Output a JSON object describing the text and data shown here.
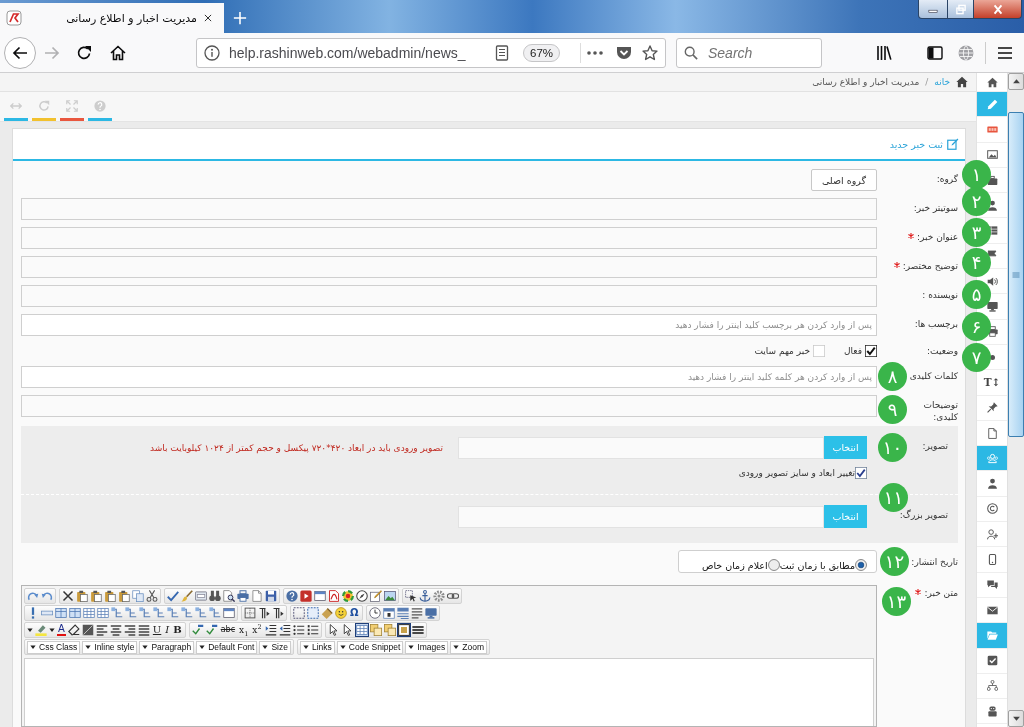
{
  "tabs": [
    {
      "title": "مدیریت اخبار و اطلاع رسانی",
      "selected": true
    }
  ],
  "navigation": {
    "back": {
      "disabled": false
    },
    "forward": {
      "disabled": true
    },
    "url": "help.rashinweb.com/webadmin/news_",
    "zoom": "67%",
    "search": {
      "placeholder": "Search"
    }
  },
  "breadcrumb": {
    "items": [
      {
        "label": "خانه",
        "kind": "link"
      },
      {
        "label": "مدیریت اخبار و اطلاع رسانی",
        "kind": "current"
      }
    ],
    "separator": "/"
  },
  "page_tools": [
    {
      "color": "#2cb8e4"
    },
    {
      "color": "#f2c12e"
    },
    {
      "color": "#e9573f"
    },
    {
      "color": "#2cb8e4"
    }
  ],
  "card": {
    "title": "ثبت خبر جدید"
  },
  "form": {
    "rows": [
      {
        "kind": "button",
        "label": "گروه:",
        "required": false,
        "button": "گروه اصلی"
      },
      {
        "kind": "text",
        "label": "سوتیتر خبر:",
        "required": false
      },
      {
        "kind": "text",
        "label": "عنوان خبر:",
        "required": true
      },
      {
        "kind": "text",
        "label": "توضیح مختصر:",
        "required": true
      },
      {
        "kind": "text",
        "label": "نویسنده :",
        "required": false
      },
      {
        "kind": "tags",
        "label": "برچسب ها:",
        "required": false,
        "placeholder": "پس از وارد کردن هر برچسب کلید اینتر را فشار دهید"
      },
      {
        "kind": "checks",
        "label": "وضعیت:",
        "required": false,
        "options": [
          {
            "label": "فعال",
            "checked": true
          },
          {
            "label": "خبر مهم سایت",
            "checked": false
          }
        ]
      },
      {
        "kind": "tags",
        "label": "کلمات کلیدی",
        "required": false,
        "placeholder": "پس از وارد کردن هر کلمه کلید اینتر را فشار دهید"
      },
      {
        "kind": "text",
        "label": "توضیحات کلیدی:",
        "required": false
      },
      {
        "kind": "file",
        "label": "تصویر:",
        "required": false,
        "button": "انتخاب",
        "note": "تصویر ورودی باید در ابعاد ۴۲۰*۷۲۰ پیکسل و حجم کمتر از ۱۰۲۴ کیلوبایت باشد",
        "option": {
          "label": "تغییر ابعاد و سایز تصویر ورودی",
          "checked": true
        }
      },
      {
        "kind": "file",
        "label": "تصویر بزرگ:",
        "required": false,
        "button": "انتخاب"
      },
      {
        "kind": "radios",
        "label": "تاریخ انتشار:",
        "required": false,
        "options": [
          {
            "label": "مطابق با زمان ثبت",
            "selected": true
          },
          {
            "label": "اعلام زمان خاص",
            "selected": false
          }
        ]
      },
      {
        "kind": "editor",
        "label": "متن خبر:",
        "required": true,
        "glyphs": [
          "Ω",
          "x$^{2}$",
          "x$_{1}$",
          "abc",
          "B",
          "I",
          "U",
          "A"
        ],
        "toggles": [
          {
            "on": true
          },
          {
            "on": true
          }
        ],
        "dropdown_groups": [
          [
            "Zoom",
            "Images",
            "Code Snippet",
            "Links"
          ],
          [
            "Size",
            "Default Font",
            "Paragraph",
            "Inline style",
            "Css Class"
          ]
        ]
      }
    ]
  },
  "sidebar": {
    "items": [
      {
        "selected": false
      },
      {
        "selected": true
      },
      {
        "selected": false
      },
      {
        "selected": false
      },
      {
        "selected": false
      },
      {
        "selected": false
      },
      {
        "selected": false
      },
      {
        "selected": false
      },
      {
        "selected": false
      },
      {
        "selected": false
      },
      {
        "selected": false
      },
      {
        "selected": false
      },
      {
        "selected": false,
        "glyph": "T↕"
      },
      {
        "selected": false
      },
      {
        "selected": false
      },
      {
        "selected": true
      },
      {
        "selected": false
      },
      {
        "selected": false
      },
      {
        "selected": false
      },
      {
        "selected": false
      },
      {
        "selected": false
      },
      {
        "selected": false
      },
      {
        "selected": true
      },
      {
        "selected": false
      },
      {
        "selected": false
      },
      {
        "selected": false
      }
    ]
  },
  "annotations": [
    {
      "label": "۱"
    },
    {
      "label": "۲"
    },
    {
      "label": "۳"
    },
    {
      "label": "۴"
    },
    {
      "label": "۵"
    },
    {
      "label": "۶"
    },
    {
      "label": "۷"
    },
    {
      "label": "۸"
    },
    {
      "label": "۹"
    },
    {
      "label": "۱۰"
    },
    {
      "label": "۱۱"
    },
    {
      "label": "۱۲"
    },
    {
      "label": "۱۳"
    }
  ]
}
